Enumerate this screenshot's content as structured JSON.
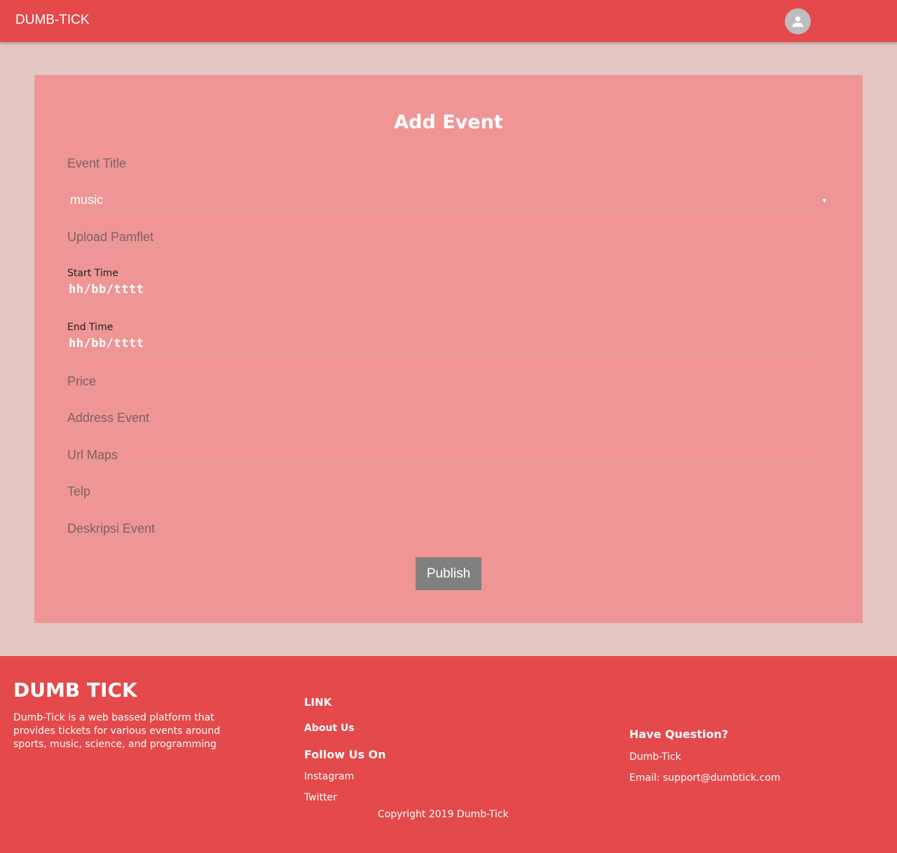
{
  "header": {
    "brand": "DUMB-TICK",
    "avatar_icon": "account-circle-icon"
  },
  "form": {
    "title": "Add Event",
    "event_title_placeholder": "Event Title",
    "category_value": "music",
    "upload_placeholder": "Upload Pamflet",
    "start_time_label": "Start Time",
    "start_time_value": "hh/bb/tttt",
    "end_time_label": "End Time",
    "end_time_value": "hh/bb/tttt",
    "price_placeholder": "Price",
    "address_placeholder": "Address Event",
    "url_maps_placeholder": "Url Maps",
    "telp_placeholder": "Telp",
    "description_placeholder": "Deskripsi Event",
    "publish_label": "Publish"
  },
  "footer": {
    "brand": "DUMB TICK",
    "description": "Dumb-Tick is a web bassed platform that provides tickets for various events around sports, music, science, and programming",
    "link_heading": "LINK",
    "about_us": "About Us",
    "follow_heading": "Follow Us On",
    "instagram": "Instagram",
    "twitter": "Twitter",
    "question_heading": "Have Question?",
    "company": "Dumb-Tick",
    "email": "Email: support@dumbtick.com",
    "copyright": "Copyright 2019 Dumb-Tick"
  },
  "colors": {
    "primary": "#e4494b",
    "card": "#ef9595",
    "background": "#e3c6c4",
    "button": "#808080"
  }
}
